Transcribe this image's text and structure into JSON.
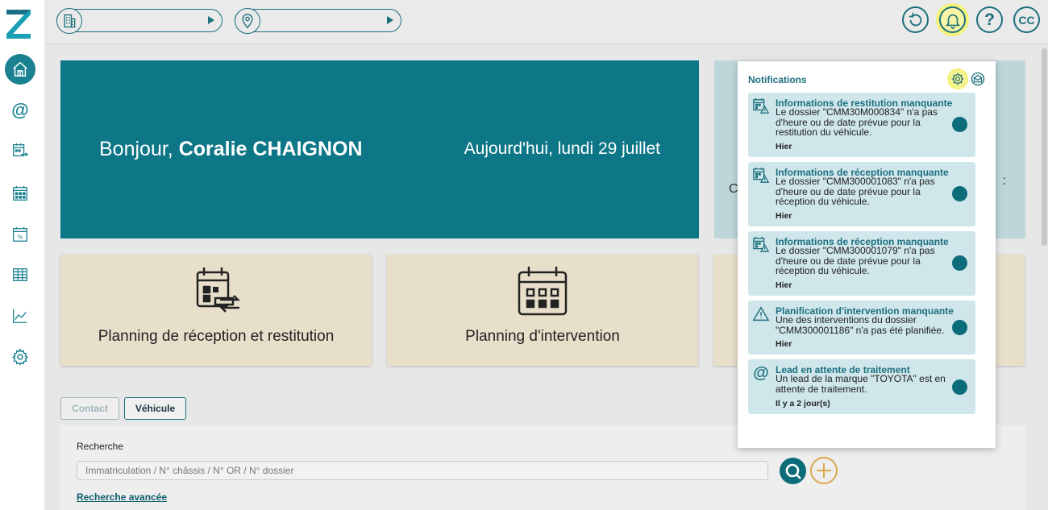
{
  "colors": {
    "primary": "#0d7687",
    "accent": "#d9a84d",
    "highlight": "#f6f48f",
    "tile": "#e8dfcb",
    "notification": "#cfe6ea"
  },
  "sidebar": {
    "items": [
      {
        "name": "home",
        "icon": "home-icon"
      },
      {
        "name": "leads",
        "icon": "at-icon"
      },
      {
        "name": "reception-planning",
        "icon": "calendar-transfer-icon"
      },
      {
        "name": "intervention-planning",
        "icon": "calendar-grid-icon"
      },
      {
        "name": "promotions",
        "icon": "calendar-percent-icon"
      },
      {
        "name": "tables",
        "icon": "table-icon"
      },
      {
        "name": "statistics",
        "icon": "chart-line-icon"
      },
      {
        "name": "settings",
        "icon": "gear-icon"
      }
    ]
  },
  "topbar": {
    "site_selector": {
      "icon": "building-icon",
      "value": ""
    },
    "location_selector": {
      "icon": "location-pin-icon",
      "value": ""
    },
    "user_initials": "CC"
  },
  "banner": {
    "greeting_prefix": "Bonjour,",
    "user_name": "Coralie CHAIGNON",
    "date_text": "Aujourd'hui, lundi 29 juillet"
  },
  "right_card": {
    "left_text": "C",
    "right_text": ":"
  },
  "tiles": [
    {
      "label": "Planning de réception et restitution",
      "icon": "calendar-transfer-icon"
    },
    {
      "label": "Planning d'intervention",
      "icon": "calendar-grid-icon"
    }
  ],
  "tabs": [
    {
      "label": "Contact",
      "active": false
    },
    {
      "label": "Véhicule",
      "active": true
    }
  ],
  "search": {
    "label": "Recherche",
    "placeholder": "Immatriculation / N° châssis / N° OR / N° dossier",
    "advanced_link": "Recherche avancée"
  },
  "notifications": {
    "title": "Notifications",
    "items": [
      {
        "icon": "calendar-warning-icon",
        "title": "Informations de restitution manquante",
        "body": "Le dossier \"CMM30M000834\" n'a pas d'heure ou de date prévue pour la restitution du véhicule.",
        "time": "Hier"
      },
      {
        "icon": "calendar-warning-icon",
        "title": "Informations de réception manquante",
        "body": "Le dossier \"CMM300001083\" n'a pas d'heure ou de date prévue pour la réception du véhicule.",
        "time": "Hier"
      },
      {
        "icon": "calendar-warning-icon",
        "title": "Informations de réception manquante",
        "body": "Le dossier \"CMM300001079\" n'a pas d'heure ou de date prévue pour la réception du véhicule.",
        "time": "Hier"
      },
      {
        "icon": "warning-triangle-icon",
        "title": "Planification d'intervention manquante",
        "body": "Une des interventions du dossier \"CMM300001186\" n'a pas été planifiée.",
        "time": "Hier"
      },
      {
        "icon": "at-icon",
        "title": "Lead en attente de traitement",
        "body": "Un lead de la marque \"TOYOTA\" est en attente de traitement.",
        "time": "Il y a 2 jour(s)"
      }
    ]
  }
}
